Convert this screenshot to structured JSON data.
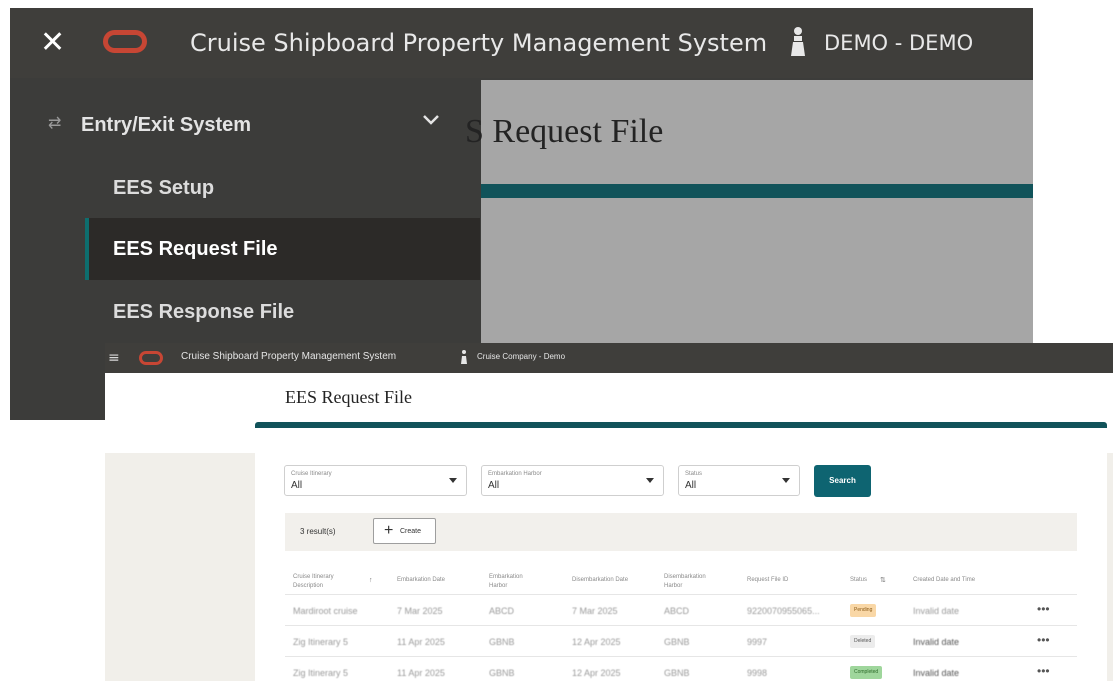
{
  "colors": {
    "brand_red": "#c74634",
    "header_dark": "#3f3e3b",
    "teal": "#11535a",
    "search_teal": "#0e6471"
  },
  "icons": [
    "close-icon",
    "oracle-logo-icon",
    "user-icon",
    "swap-arrows-icon",
    "chevron-down-icon",
    "hamburger-icon",
    "plus-icon",
    "sort-icon",
    "more-options-icon"
  ],
  "back": {
    "app_title": "Cruise Shipboard Property Management System",
    "user": "DEMO - DEMO",
    "close_glyph": "✕",
    "nav": {
      "group_label": "Entry/Exit System",
      "items": [
        {
          "label": "EES Setup"
        },
        {
          "label": "EES Request File"
        },
        {
          "label": "EES Response File"
        }
      ]
    },
    "content_heading": "S Request File"
  },
  "front": {
    "app_title": "Cruise Shipboard Property Management System",
    "user": "Cruise Company - Demo",
    "hamburger_glyph": "≡",
    "page_title": "EES Request File",
    "filters": [
      {
        "label": "Cruise Itinerary",
        "value": "All"
      },
      {
        "label": "Embarkation Harbor",
        "value": "All"
      },
      {
        "label": "Status",
        "value": "All"
      }
    ],
    "search_label": "Search",
    "results_count": "3 result(s)",
    "create_label": "Create",
    "plus_glyph": "+",
    "sort_glyph": "↑",
    "sort_glyph_2": "⇅",
    "more_glyph": "•••",
    "columns": [
      "Cruise Itinerary\nDescription",
      "Embarkation Date",
      "Embarkation\nHarbor",
      "Disembarkation Date",
      "Disembarkation\nHarbor",
      "Request File ID",
      "Status",
      "Created Date and Time"
    ],
    "rows": [
      {
        "itinerary": "Mardiroot cruise",
        "emb_date": "7 Mar 2025",
        "emb_harbor": "ABCD",
        "dis_date": "7 Mar 2025",
        "dis_harbor": "ABCD",
        "file_id": "9220070955065...",
        "status": "Pending",
        "created": "Invalid date"
      },
      {
        "itinerary": "Zig Itinerary 5",
        "emb_date": "11 Apr 2025",
        "emb_harbor": "GBNB",
        "dis_date": "12 Apr 2025",
        "dis_harbor": "GBNB",
        "file_id": "9997",
        "status": "Deleted",
        "created": "Invalid date"
      },
      {
        "itinerary": "Zig Itinerary 5",
        "emb_date": "11 Apr 2025",
        "emb_harbor": "GBNB",
        "dis_date": "12 Apr 2025",
        "dis_harbor": "GBNB",
        "file_id": "9998",
        "status": "Completed",
        "created": "Invalid date"
      }
    ],
    "status_colors": {
      "Pending": {
        "bg": "#f9d7a6",
        "fg": "#8a5a16"
      },
      "Deleted": {
        "bg": "#ececec",
        "fg": "#555555"
      },
      "Completed": {
        "bg": "#9fd69c",
        "fg": "#2d6a2a"
      }
    }
  }
}
